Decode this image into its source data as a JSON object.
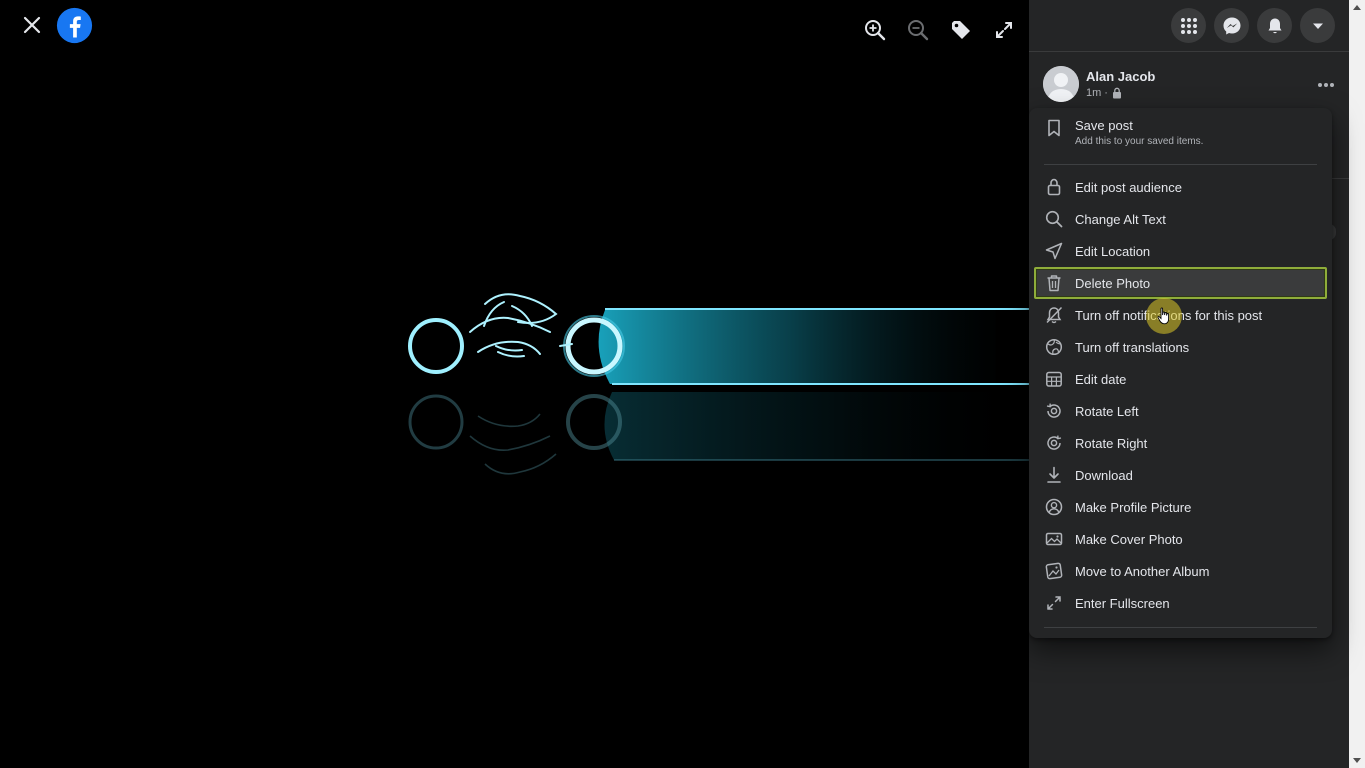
{
  "viewer": {
    "close_icon": "close-icon",
    "logo_icon": "facebook-logo-icon",
    "tools": [
      {
        "name": "zoom-in",
        "icon": "zoom-in-icon"
      },
      {
        "name": "zoom-out",
        "icon": "zoom-out-icon"
      },
      {
        "name": "tag",
        "icon": "tag-icon"
      },
      {
        "name": "fullscreen",
        "icon": "expand-icon"
      }
    ]
  },
  "topbar": {
    "icons": [
      "menu-grid-icon",
      "messenger-icon",
      "notifications-bell-icon",
      "account-caret-icon"
    ]
  },
  "post": {
    "author": "Alan Jacob",
    "time": "1m",
    "privacy_icon": "lock-icon"
  },
  "menu": {
    "save": {
      "label": "Save post",
      "sub": "Add this to your saved items.",
      "icon": "bookmark-icon"
    },
    "items": [
      {
        "label": "Edit post audience",
        "icon": "lock-icon"
      },
      {
        "label": "Change Alt Text",
        "icon": "search-icon"
      },
      {
        "label": "Edit Location",
        "icon": "location-arrow-icon"
      },
      {
        "label": "Delete Photo",
        "icon": "trash-icon"
      },
      {
        "label": "Turn off notifications for this post",
        "icon": "bell-off-icon"
      },
      {
        "label": "Turn off translations",
        "icon": "globe-icon"
      },
      {
        "label": "Edit date",
        "icon": "calendar-icon"
      },
      {
        "label": "Rotate Left",
        "icon": "rotate-left-icon"
      },
      {
        "label": "Rotate Right",
        "icon": "rotate-right-icon"
      },
      {
        "label": "Download",
        "icon": "download-icon"
      },
      {
        "label": "Make Profile Picture",
        "icon": "profile-picture-icon"
      },
      {
        "label": "Make Cover Photo",
        "icon": "cover-photo-icon"
      },
      {
        "label": "Move to Another Album",
        "icon": "album-icon"
      },
      {
        "label": "Enter Fullscreen",
        "icon": "enter-fullscreen-icon"
      }
    ],
    "highlighted_index": 3
  },
  "colors": {
    "panel": "#242526",
    "text": "#e4e6eb",
    "subtext": "#b0b3b8",
    "facebook_blue": "#1877f2",
    "neon_cyan": "#7fe6ff",
    "highlight_outline": "#8fad3a"
  }
}
